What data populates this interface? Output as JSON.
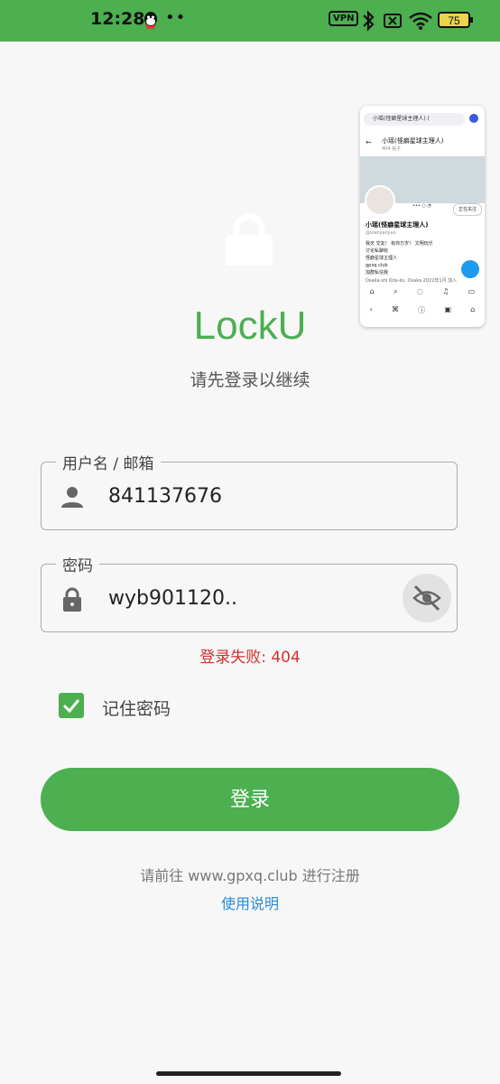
{
  "status_bar": {
    "time": "12:28",
    "dots": "••",
    "vpn_label": "VPN",
    "battery_level": "75",
    "accent_color": "#4caf50"
  },
  "app": {
    "title": "LockU",
    "subtitle": "请先登录以继续"
  },
  "form": {
    "username": {
      "label": "用户名 / 邮箱",
      "value": "841137676",
      "icon": "person-icon"
    },
    "password": {
      "label": "密码",
      "value": "wyb901120..",
      "icon": "lock-icon",
      "toggle_icon": "eye-off-icon"
    },
    "error": "登录失败: 404",
    "remember": {
      "label": "记住密码",
      "checked": true
    },
    "submit_label": "登录"
  },
  "footer": {
    "register_text": "请前往 www.gpxq.club 进行注册",
    "help_link": "使用说明"
  },
  "pip": {
    "url": "小瑶(怪癖星球主理人) (",
    "header_name": "小瑶(怪癖星球主理人)",
    "header_sub": "404 帖子",
    "follow_label": "正在关注",
    "name": "小瑶(怪癖星球主理人)",
    "handle": "@xiaoyaoyao",
    "bio": "我天 交友！ 有你万岁！ 文明玩乐\n讨论私聊收\n怪癖星球主理人\ngpxq.club\n加群私信我",
    "location": "Osaka-shi Kita-ku, Osaka  2022年1月 加入"
  }
}
